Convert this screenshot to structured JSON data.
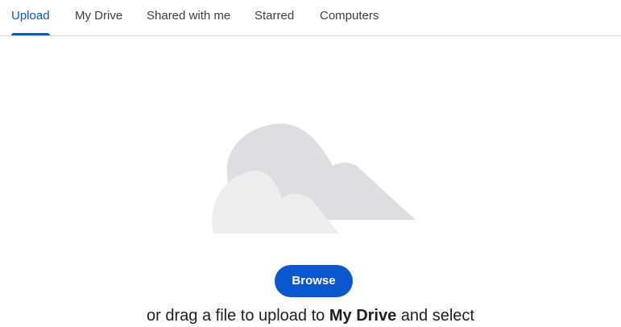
{
  "tabs": [
    {
      "label": "Upload",
      "active": true
    },
    {
      "label": "My Drive",
      "active": false
    },
    {
      "label": "Shared with me",
      "active": false
    },
    {
      "label": "Starred",
      "active": false
    },
    {
      "label": "Computers",
      "active": false
    }
  ],
  "illustration": {
    "icon": "cloud-upload-icon"
  },
  "upload": {
    "browse_label": "Browse",
    "drag_text_before": "or drag a file to upload to ",
    "drag_text_target": "My Drive",
    "drag_text_after": " and select"
  },
  "colors": {
    "accent": "#0b57d0",
    "cloud_back": "#dcdee2",
    "cloud_front": "#eceef0"
  }
}
